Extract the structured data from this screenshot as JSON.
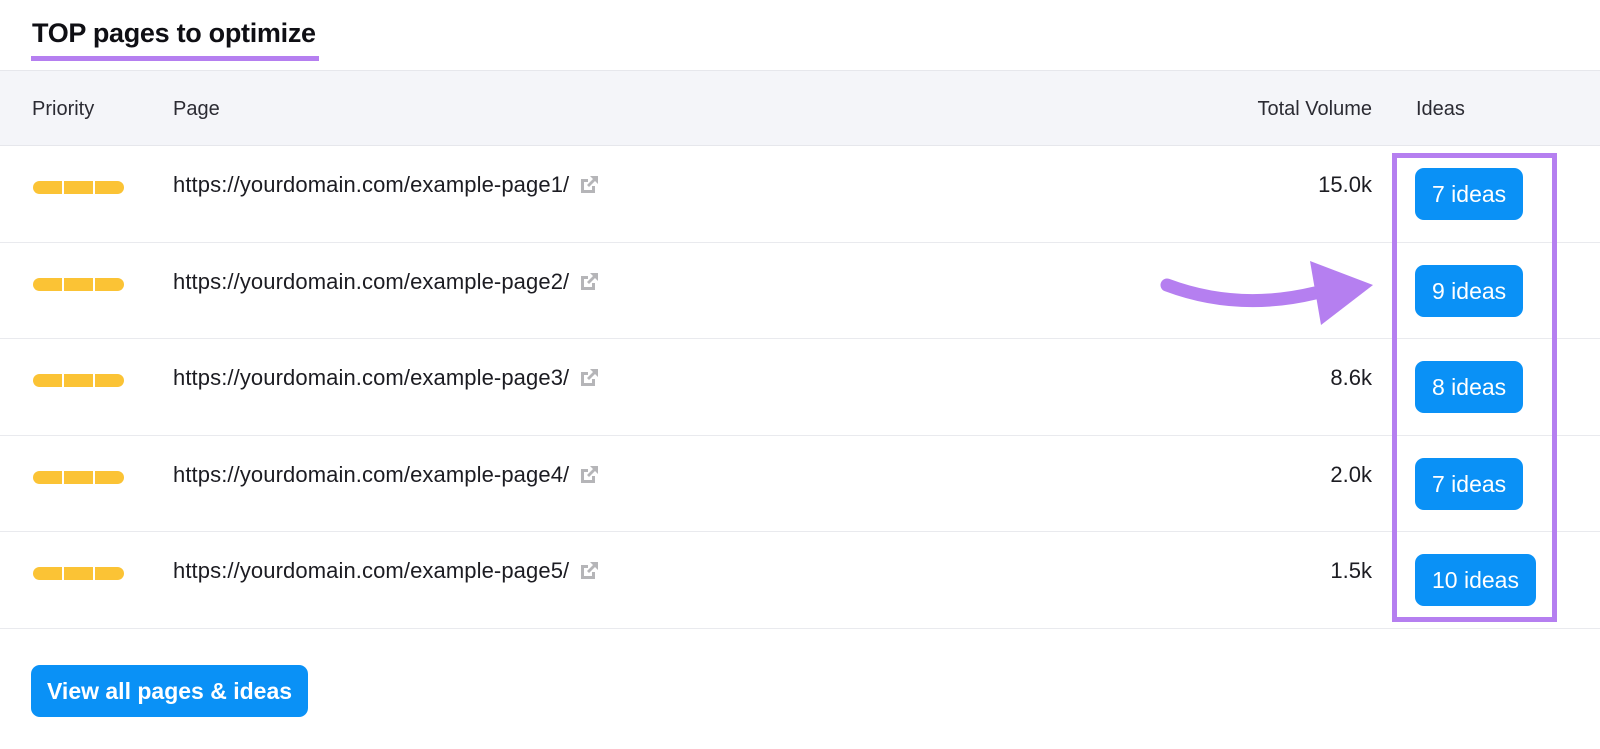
{
  "header": {
    "title": "TOP pages to optimize"
  },
  "table": {
    "columns": {
      "priority": "Priority",
      "page": "Page",
      "total_volume": "Total Volume",
      "ideas": "Ideas"
    },
    "rows": [
      {
        "priority_level": 3,
        "url": "https://yourdomain.com/example-page1/",
        "total_volume": "15.0k",
        "ideas": "7 ideas"
      },
      {
        "priority_level": 3,
        "url": "https://yourdomain.com/example-page2/",
        "total_volume": "",
        "ideas": "9 ideas"
      },
      {
        "priority_level": 3,
        "url": "https://yourdomain.com/example-page3/",
        "total_volume": "8.6k",
        "ideas": "8 ideas"
      },
      {
        "priority_level": 3,
        "url": "https://yourdomain.com/example-page4/",
        "total_volume": "2.0k",
        "ideas": "7 ideas"
      },
      {
        "priority_level": 3,
        "url": "https://yourdomain.com/example-page5/",
        "total_volume": "1.5k",
        "ideas": "10 ideas"
      }
    ]
  },
  "footer": {
    "view_all_label": "View all pages & ideas"
  },
  "icons": {
    "external_link": "external-link-icon",
    "annotation_arrow": "arrow-right-icon"
  },
  "colors": {
    "accent_purple": "#b57ff0",
    "button_blue": "#0a91f6",
    "priority_yellow": "#fbc335",
    "header_bg": "#f4f5f9"
  }
}
